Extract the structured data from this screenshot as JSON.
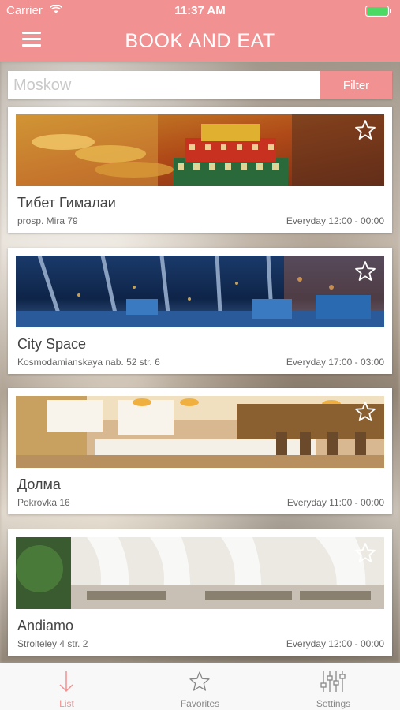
{
  "status_bar": {
    "carrier": "Carrier",
    "time": "11:37 AM"
  },
  "header": {
    "title": "BOOK AND EAT",
    "menu_icon": "hamburger-menu-icon"
  },
  "search": {
    "value": "",
    "placeholder": "Moskow",
    "filter_label": "Filter"
  },
  "restaurants": [
    {
      "name": "Тибет Гималаи",
      "address": "prosp. Mira 79",
      "hours": "Everyday 12:00 - 00:00",
      "favorite": false
    },
    {
      "name": "City Space",
      "address": "Kosmodamianskaya nab. 52 str. 6",
      "hours": "Everyday 17:00 - 03:00",
      "favorite": false
    },
    {
      "name": "Долма",
      "address": "Pokrovka 16",
      "hours": "Everyday 11:00 - 00:00",
      "favorite": false
    },
    {
      "name": "Andiamo",
      "address": "Stroiteley 4 str. 2",
      "hours": "Everyday 12:00 - 00:00",
      "favorite": false
    }
  ],
  "tabbar": {
    "tabs": [
      {
        "label": "List",
        "icon": "arrow-down-icon",
        "active": true
      },
      {
        "label": "Favorites",
        "icon": "star-icon",
        "active": false
      },
      {
        "label": "Settings",
        "icon": "sliders-icon",
        "active": false
      }
    ]
  },
  "colors": {
    "accent": "#f29191",
    "text": "#444444",
    "secondary_text": "#666666"
  }
}
